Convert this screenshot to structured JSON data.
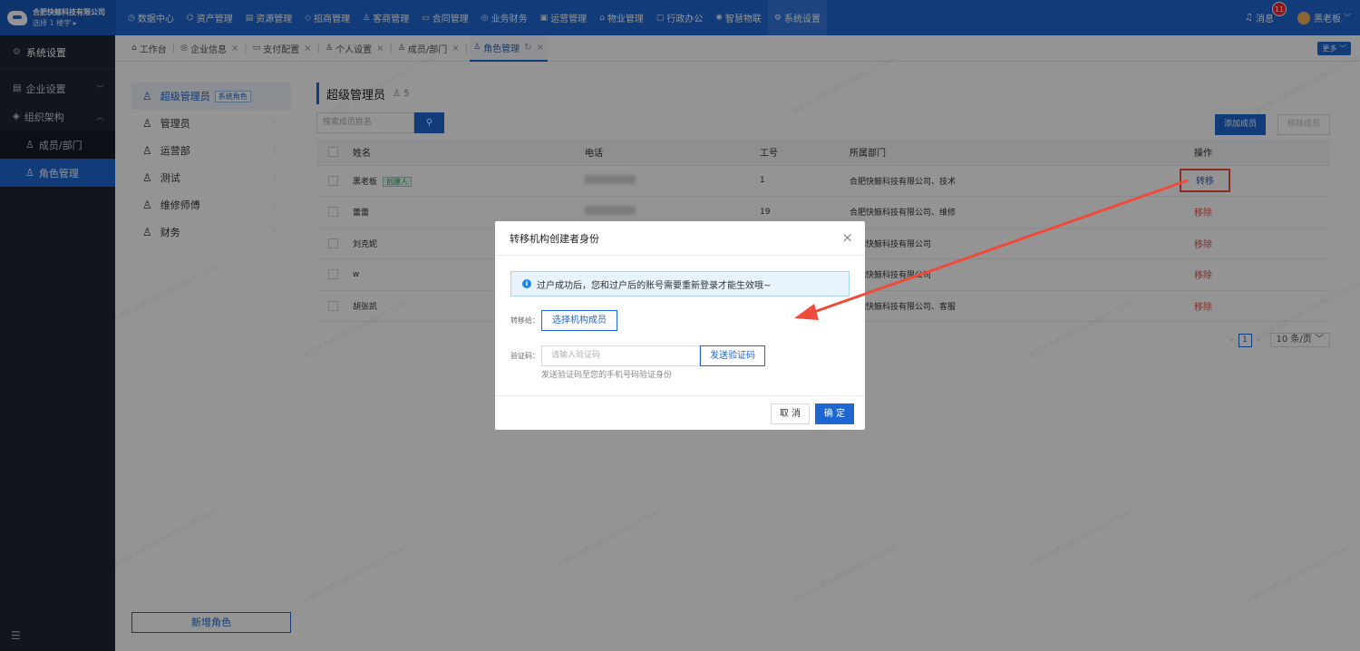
{
  "brand": {
    "name": "合肥快鲸科技有限公司",
    "sub": "选择 1 楼宇 ▸"
  },
  "topnav": [
    {
      "label": "数据中心",
      "icon": "◷"
    },
    {
      "label": "资产管理",
      "icon": "⌬"
    },
    {
      "label": "资源管理",
      "icon": "▤"
    },
    {
      "label": "招商管理",
      "icon": "◇"
    },
    {
      "label": "客商管理",
      "icon": "♙"
    },
    {
      "label": "合同管理",
      "icon": "▭"
    },
    {
      "label": "业务财务",
      "icon": "◎"
    },
    {
      "label": "运营管理",
      "icon": "▣"
    },
    {
      "label": "物业管理",
      "icon": "⌂"
    },
    {
      "label": "行政办公",
      "icon": "▢"
    },
    {
      "label": "智慧物联",
      "icon": "✺"
    },
    {
      "label": "系统设置",
      "icon": "⚙"
    }
  ],
  "topright": {
    "messages": "消息",
    "badge": "11",
    "user": "黑老板"
  },
  "sidebar": {
    "title": "系统设置",
    "items": [
      {
        "label": "企业设置"
      },
      {
        "label": "组织架构"
      }
    ],
    "subitems": [
      {
        "label": "成员/部门"
      },
      {
        "label": "角色管理"
      }
    ],
    "footer_icon": "☰"
  },
  "tabs": [
    {
      "label": "工作台"
    },
    {
      "label": "企业信息"
    },
    {
      "label": "支付配置"
    },
    {
      "label": "个人设置"
    },
    {
      "label": "成员/部门"
    },
    {
      "label": "角色管理"
    }
  ],
  "more_label": "更多 ﹀",
  "roles": [
    {
      "label": "超级管理员",
      "tag": "系统角色"
    },
    {
      "label": "管理员"
    },
    {
      "label": "运营部"
    },
    {
      "label": "测试"
    },
    {
      "label": "维修师傅"
    },
    {
      "label": "财务"
    }
  ],
  "add_role": "新增角色",
  "main": {
    "title": "超级管理员",
    "count": "5",
    "search_placeholder": "搜索成员姓名",
    "add_member": "添加成员",
    "remove_member": "移除成员"
  },
  "table": {
    "headers": [
      "姓名",
      "电话",
      "工号",
      "所属部门",
      "操作"
    ],
    "rows": [
      {
        "name": "黑老板",
        "tag": "创建人",
        "id": "1",
        "dept": "合肥快鲸科技有限公司、技术",
        "op": "转移"
      },
      {
        "name": "蕾蕾",
        "id": "19",
        "dept": "合肥快鲸科技有限公司、维修",
        "op": "移除"
      },
      {
        "name": "刘克妮",
        "id": "",
        "dept": "合肥快鲸科技有限公司",
        "op": "移除"
      },
      {
        "name": "w",
        "id": "",
        "dept": "合肥快鲸科技有限公司",
        "op": "移除"
      },
      {
        "name": "胡张凯",
        "id": "",
        "dept": "合肥快鲸科技有限公司、客服",
        "op": "移除"
      }
    ]
  },
  "pager": {
    "current": "1",
    "size": "10 条/页"
  },
  "modal": {
    "title": "转移机构创建者身份",
    "alert": "过户成功后，您和过户后的账号需要重新登录才能生效哦~",
    "transfer_label": "转移给：",
    "select_member": "选择机构成员",
    "code_label": "验证码：",
    "code_placeholder": "请输入验证码",
    "send_code": "发送验证码",
    "hint": "发送验证码至您的手机号码验证身份",
    "cancel": "取 消",
    "ok": "确 定"
  },
  "colors": {
    "primary": "#1e66d0",
    "danger": "#f04b3a",
    "sidebar": "#1f2533"
  }
}
